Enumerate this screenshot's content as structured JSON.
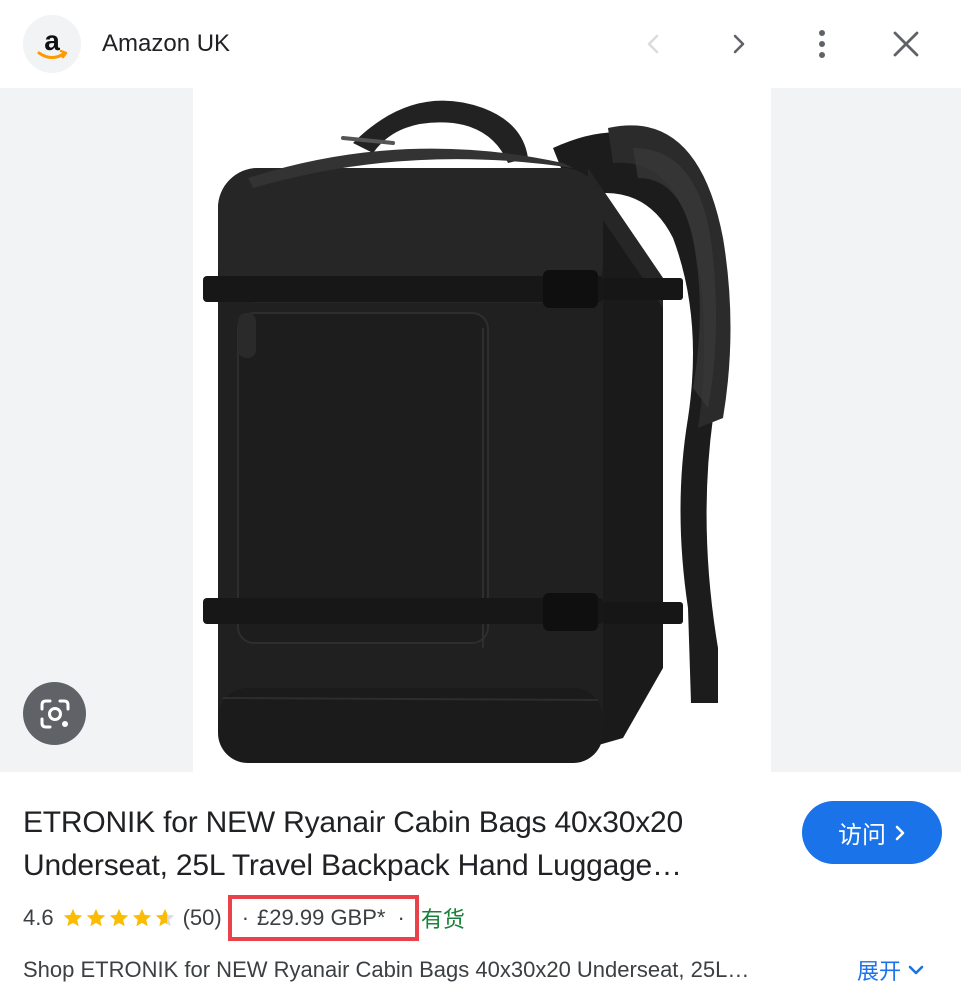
{
  "header": {
    "site_name": "Amazon UK",
    "logo_letter": "a",
    "prev_icon": "chevron-left-icon",
    "next_icon": "chevron-right-icon",
    "more_icon": "more-vert-icon",
    "close_icon": "close-icon"
  },
  "product": {
    "title_line_1": "ETRONIK for NEW Ryanair Cabin Bags 40x30x20",
    "title_line_2": "Underseat, 25L Travel Backpack Hand Luggage…",
    "rating": "4.6",
    "stars": 4.6,
    "reviews": "(50)",
    "separator": "·",
    "price": "£29.99 GBP*",
    "stock": "有货",
    "description": "Shop ETRONIK for NEW Ryanair Cabin Bags 40x30x20 Underseat, 25L…"
  },
  "actions": {
    "visit_label": "访问",
    "expand_label": "展开",
    "lens_icon": "google-lens-icon"
  },
  "colors": {
    "accent": "#1a73e8",
    "stock_green": "#188038",
    "star_gold": "#fbbc04",
    "highlight_red": "#e8434b"
  }
}
